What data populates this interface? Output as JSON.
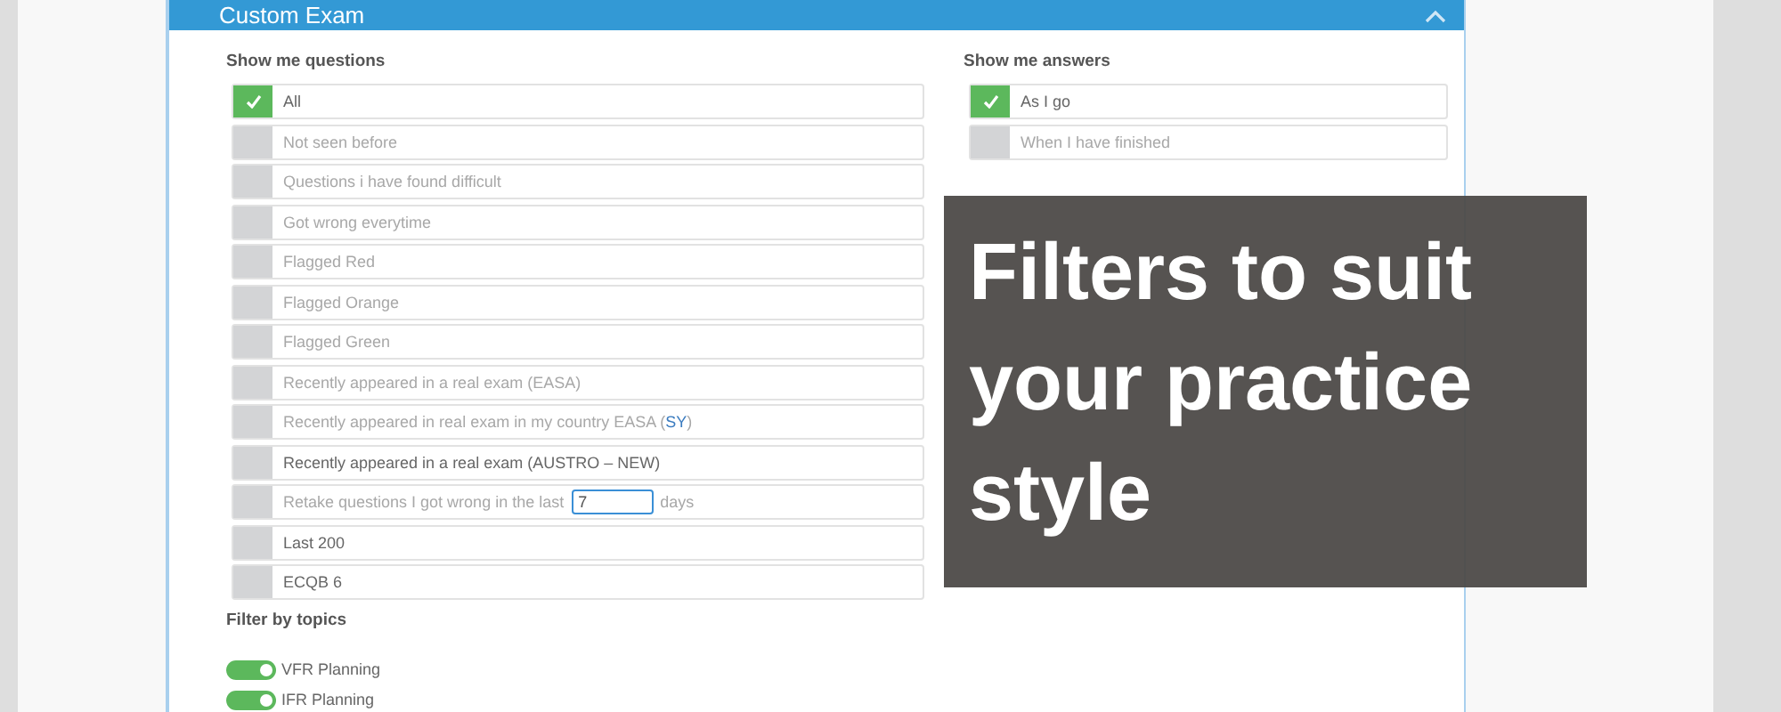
{
  "panel": {
    "title": "Custom Exam",
    "expanded": true
  },
  "questions": {
    "heading": "Show me questions",
    "options": [
      {
        "kind": "plain",
        "label": "All",
        "checked": true,
        "dimmed": false
      },
      {
        "kind": "plain",
        "label": "Not seen before",
        "checked": false,
        "dimmed": true
      },
      {
        "kind": "plain",
        "label": "Questions i have found difficult",
        "checked": false,
        "dimmed": true
      },
      {
        "kind": "plain",
        "label": "Got wrong everytime",
        "checked": false,
        "dimmed": true
      },
      {
        "kind": "plain",
        "label": "Flagged Red",
        "checked": false,
        "dimmed": true
      },
      {
        "kind": "plain",
        "label": "Flagged Orange",
        "checked": false,
        "dimmed": true
      },
      {
        "kind": "plain",
        "label": "Flagged Green",
        "checked": false,
        "dimmed": true
      },
      {
        "kind": "plain",
        "label": "Recently appeared in a real exam (EASA)",
        "checked": false,
        "dimmed": true
      },
      {
        "kind": "parts",
        "parts": [
          {
            "text": "Recently appeared in real exam in my country EASA (",
            "accent": false
          },
          {
            "text": "SY",
            "accent": true
          },
          {
            "text": ")",
            "accent": false
          }
        ],
        "checked": false,
        "dimmed": true
      },
      {
        "kind": "plain",
        "label": "Recently appeared in a real exam (AUSTRO – NEW)",
        "checked": false,
        "dimmed": false
      },
      {
        "kind": "days",
        "label": "Retake questions I got wrong in the last",
        "value": "7",
        "suffix": "days",
        "checked": false,
        "dimmed": true
      },
      {
        "kind": "plain",
        "label": "Last 200",
        "checked": false,
        "dimmed": false
      },
      {
        "kind": "plain",
        "label": "ECQB 6",
        "checked": false,
        "dimmed": false
      }
    ]
  },
  "answers": {
    "heading": "Show me answers",
    "options": [
      {
        "kind": "plain",
        "label": "As I go",
        "checked": true,
        "dimmed": false
      },
      {
        "kind": "plain",
        "label": "When I have finished",
        "checked": false,
        "dimmed": true
      }
    ]
  },
  "topics": {
    "heading": "Filter by topics",
    "items": [
      {
        "label": "VFR Planning",
        "on": true
      },
      {
        "label": "IFR Planning",
        "on": true
      }
    ]
  },
  "banner": {
    "text": "Filters to suit your practice style"
  }
}
